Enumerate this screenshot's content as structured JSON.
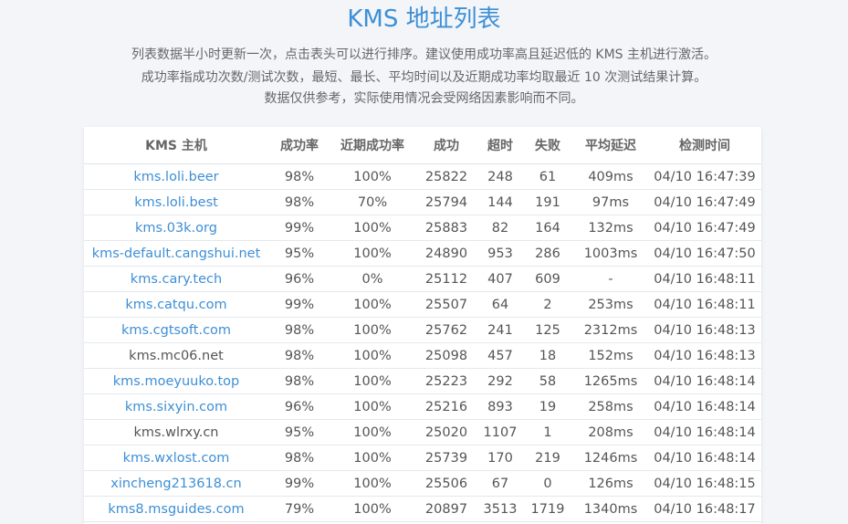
{
  "header": {
    "title": "KMS 地址列表",
    "desc_1": "列表数据半小时更新一次，点击表头可以进行排序。建议使用成功率高且延迟低的 KMS 主机进行激活。",
    "desc_2": "成功率指成功次数/测试次数，最短、最长、平均时间以及近期成功率均取最近 10 次测试结果计算。",
    "desc_3": "数据仅供参考，实际使用情况会受网络因素影响而不同。"
  },
  "table": {
    "columns": [
      "KMS 主机",
      "成功率",
      "近期成功率",
      "成功",
      "超时",
      "失败",
      "平均延迟",
      "检测时间"
    ],
    "rows": [
      {
        "host": "kms.loli.beer",
        "link": true,
        "rate": "98%",
        "recent": "100%",
        "ok": "25822",
        "timeout": "248",
        "fail": "61",
        "latency": "409ms",
        "time": "04/10 16:47:39"
      },
      {
        "host": "kms.loli.best",
        "link": true,
        "rate": "98%",
        "recent": "70%",
        "ok": "25794",
        "timeout": "144",
        "fail": "191",
        "latency": "97ms",
        "time": "04/10 16:47:49"
      },
      {
        "host": "kms.03k.org",
        "link": true,
        "rate": "99%",
        "recent": "100%",
        "ok": "25883",
        "timeout": "82",
        "fail": "164",
        "latency": "132ms",
        "time": "04/10 16:47:49"
      },
      {
        "host": "kms-default.cangshui.net",
        "link": true,
        "rate": "95%",
        "recent": "100%",
        "ok": "24890",
        "timeout": "953",
        "fail": "286",
        "latency": "1003ms",
        "time": "04/10 16:47:50"
      },
      {
        "host": "kms.cary.tech",
        "link": true,
        "rate": "96%",
        "recent": "0%",
        "ok": "25112",
        "timeout": "407",
        "fail": "609",
        "latency": "-",
        "time": "04/10 16:48:11"
      },
      {
        "host": "kms.catqu.com",
        "link": true,
        "rate": "99%",
        "recent": "100%",
        "ok": "25507",
        "timeout": "64",
        "fail": "2",
        "latency": "253ms",
        "time": "04/10 16:48:11"
      },
      {
        "host": "kms.cgtsoft.com",
        "link": true,
        "rate": "98%",
        "recent": "100%",
        "ok": "25762",
        "timeout": "241",
        "fail": "125",
        "latency": "2312ms",
        "time": "04/10 16:48:13"
      },
      {
        "host": "kms.mc06.net",
        "link": false,
        "rate": "98%",
        "recent": "100%",
        "ok": "25098",
        "timeout": "457",
        "fail": "18",
        "latency": "152ms",
        "time": "04/10 16:48:13"
      },
      {
        "host": "kms.moeyuuko.top",
        "link": true,
        "rate": "98%",
        "recent": "100%",
        "ok": "25223",
        "timeout": "292",
        "fail": "58",
        "latency": "1265ms",
        "time": "04/10 16:48:14"
      },
      {
        "host": "kms.sixyin.com",
        "link": true,
        "rate": "96%",
        "recent": "100%",
        "ok": "25216",
        "timeout": "893",
        "fail": "19",
        "latency": "258ms",
        "time": "04/10 16:48:14"
      },
      {
        "host": "kms.wlrxy.cn",
        "link": false,
        "rate": "95%",
        "recent": "100%",
        "ok": "25020",
        "timeout": "1107",
        "fail": "1",
        "latency": "208ms",
        "time": "04/10 16:48:14"
      },
      {
        "host": "kms.wxlost.com",
        "link": true,
        "rate": "98%",
        "recent": "100%",
        "ok": "25739",
        "timeout": "170",
        "fail": "219",
        "latency": "1246ms",
        "time": "04/10 16:48:14"
      },
      {
        "host": "xincheng213618.cn",
        "link": true,
        "rate": "99%",
        "recent": "100%",
        "ok": "25506",
        "timeout": "67",
        "fail": "0",
        "latency": "126ms",
        "time": "04/10 16:48:15"
      },
      {
        "host": "kms8.msguides.com",
        "link": true,
        "rate": "79%",
        "recent": "100%",
        "ok": "20897",
        "timeout": "3513",
        "fail": "1719",
        "latency": "1340ms",
        "time": "04/10 16:48:17"
      }
    ]
  },
  "colors": {
    "accent": "#3d8fd6",
    "background": "#f3f5f8",
    "text": "#555555"
  }
}
